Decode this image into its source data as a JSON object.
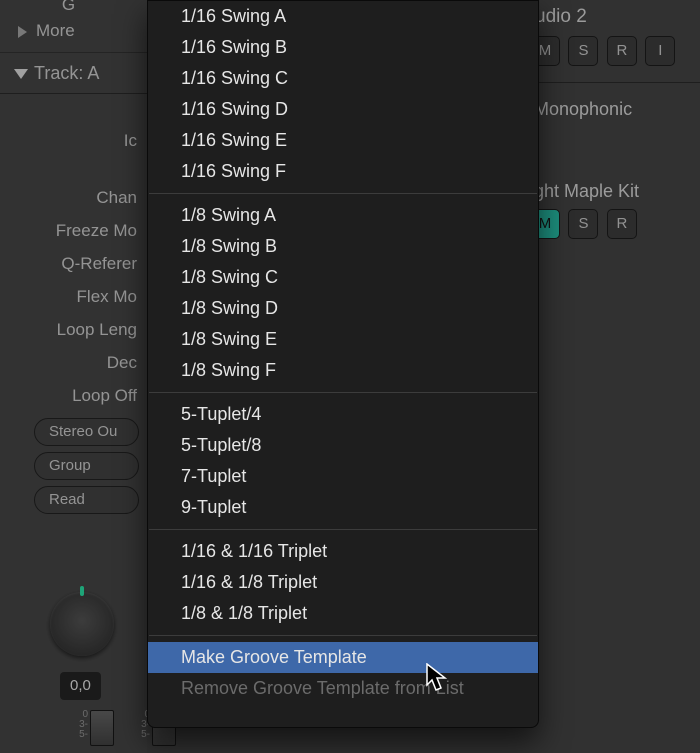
{
  "inspector": {
    "g_row": "G",
    "more": "More",
    "track_header": "Track:    A",
    "rows": {
      "icon": "Ic",
      "channel": "Chan",
      "freeze": "Freeze Mo",
      "qref": "Q-Referer",
      "flex": "Flex Mo",
      "looplen": "Loop Leng",
      "dec": "Dec",
      "loopoff": "Loop Off"
    },
    "buttons": {
      "stereo": "Stereo Ou",
      "group": "Group",
      "read": "Read"
    },
    "readout": "0,0",
    "fader_scale": {
      "top": "0",
      "mid": "3-",
      "bot": "5-"
    }
  },
  "rightpane": {
    "title": "udio 2",
    "row1": [
      "M",
      "S",
      "R",
      "I"
    ],
    "mode": "Monophonic",
    "kit": "ght Maple Kit",
    "row2": [
      "M",
      "S",
      "R"
    ],
    "row2_active_index": 0
  },
  "menu": {
    "groups": [
      [
        "1/16 Swing A",
        "1/16 Swing B",
        "1/16 Swing C",
        "1/16 Swing D",
        "1/16 Swing E",
        "1/16 Swing F"
      ],
      [
        "1/8 Swing A",
        "1/8 Swing B",
        "1/8 Swing C",
        "1/8 Swing D",
        "1/8 Swing E",
        "1/8 Swing F"
      ],
      [
        "5-Tuplet/4",
        "5-Tuplet/8",
        "7-Tuplet",
        "9-Tuplet"
      ],
      [
        "1/16 & 1/16 Triplet",
        "1/16 & 1/8 Triplet",
        "1/8 & 1/8 Triplet"
      ]
    ],
    "footer": {
      "make": "Make Groove Template",
      "remove": "Remove Groove Template from List"
    },
    "highlight_path": "footer.make"
  }
}
